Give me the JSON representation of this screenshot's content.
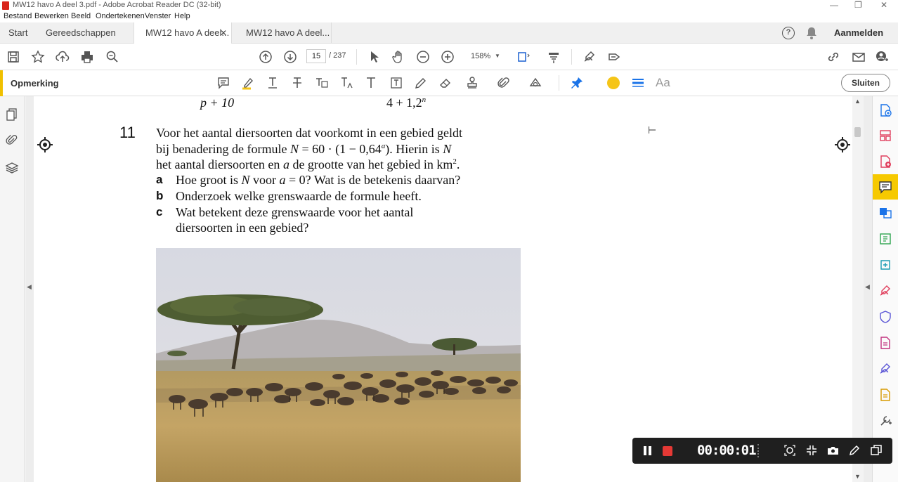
{
  "window": {
    "title": "MW12 havo A deel 3.pdf - Adobe Acrobat Reader DC (32-bit)"
  },
  "menu": [
    "Bestand",
    "Bewerken",
    "Beeld",
    "Ondertekenen",
    "Venster",
    "Help"
  ],
  "tabs": {
    "home": "Start",
    "tools": "Gereedschappen",
    "doc1": "MW12 havo A deel...",
    "doc2": "MW12 havo A deel...",
    "signin": "Aanmelden"
  },
  "toolbar": {
    "page_current": "15",
    "page_total": "/ 237",
    "zoom": "158%"
  },
  "comment_toolbar": {
    "label": "Opmerking",
    "close_label": "Sluiten",
    "font_label": "Aa",
    "color_accent": "#f5c518"
  },
  "document": {
    "top_partial_left": "p + 10",
    "top_partial_right": "4 + 1,2",
    "top_partial_right_sup": "n",
    "exercise_number": "11",
    "intro_line1": "Voor het aantal diersoorten dat voorkomt in een gebied geldt",
    "intro_line2_a": "bij benadering de formule ",
    "intro_line2_b": "N",
    "intro_line2_c": " = 60 · (1 − 0,64",
    "intro_line2_sup": "a",
    "intro_line2_d": "). Hierin is ",
    "intro_line2_e": "N",
    "intro_line3_a": "het aantal diersoorten en ",
    "intro_line3_b": "a",
    "intro_line3_c": " de grootte van het gebied in km",
    "intro_line3_sup": "2",
    "intro_line3_d": ".",
    "questions": [
      {
        "letter": "a",
        "text_a": "Hoe groot is ",
        "text_b": "N",
        "text_c": " voor ",
        "text_d": "a",
        "text_e": " = 0? Wat is de betekenis daarvan?"
      },
      {
        "letter": "b",
        "text": "Onderzoek welke grenswaarde de formule heeft."
      },
      {
        "letter": "c",
        "text": "Wat betekent deze grenswaarde voor het aantal",
        "text2": "diersoorten in een gebied?"
      }
    ]
  },
  "recorder": {
    "time": "00:00:01"
  }
}
